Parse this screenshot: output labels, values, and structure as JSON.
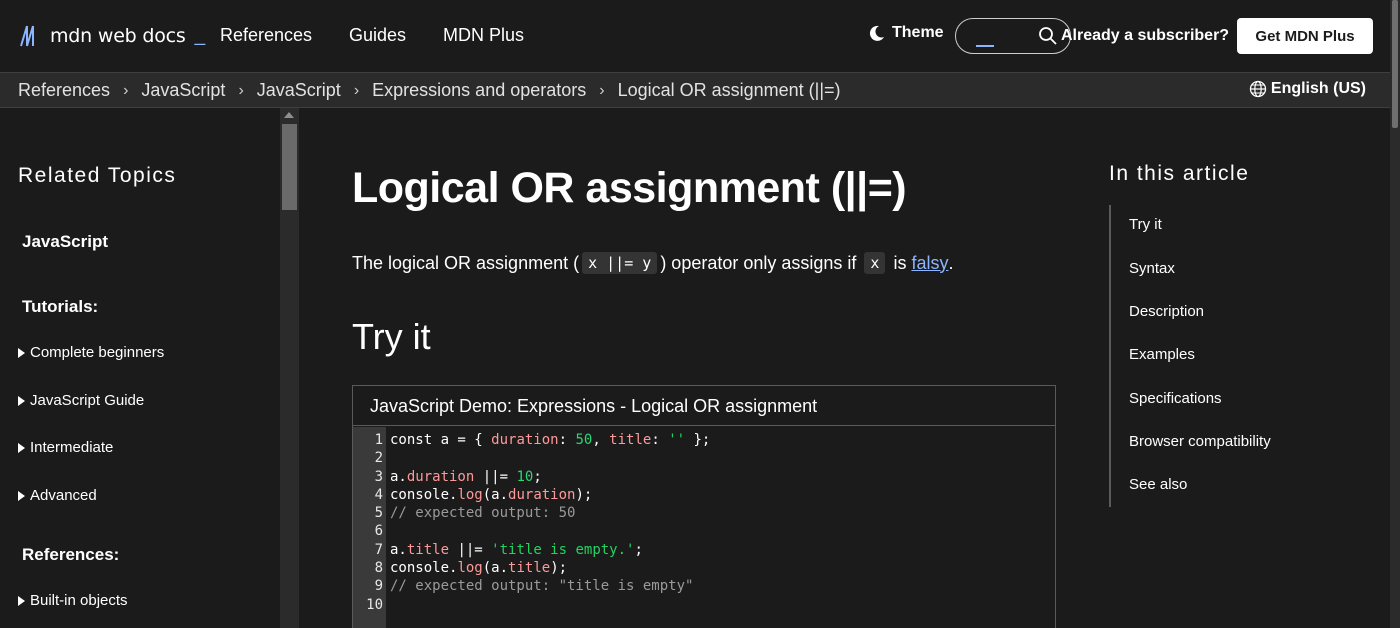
{
  "header": {
    "logo_text": "mdn web docs",
    "logo_underscore": "_",
    "nav": [
      "References",
      "Guides",
      "MDN Plus"
    ],
    "theme_label": "Theme",
    "search": {
      "value": "",
      "placeholder": ""
    },
    "subscriber_text": "Already a subscriber?",
    "get_plus_label": "Get MDN Plus"
  },
  "breadcrumb": {
    "items": [
      "References",
      "JavaScript",
      "JavaScript",
      "Expressions and operators",
      "Logical OR assignment (||=)"
    ],
    "separator": ">",
    "language": "English (US)"
  },
  "sidebar": {
    "heading": "Related Topics",
    "top_link": "JavaScript",
    "tutorials_heading": "Tutorials:",
    "tutorials": [
      "Complete beginners",
      "JavaScript Guide",
      "Intermediate",
      "Advanced"
    ],
    "references_heading": "References:",
    "references": [
      "Built-in objects"
    ]
  },
  "article": {
    "title": "Logical OR assignment (||=)",
    "intro": {
      "before": "The logical OR assignment (",
      "code1": "x ||= y",
      "middle": ") operator only assigns if ",
      "code2": "x",
      "is": " is ",
      "link": "falsy",
      "end": "."
    },
    "try_it_heading": "Try it",
    "demo_title": "JavaScript Demo: Expressions - Logical OR assignment",
    "code_line_numbers": [
      "1",
      "2",
      "3",
      "4",
      "5",
      "6",
      "7",
      "8",
      "9",
      "10"
    ]
  },
  "toc": {
    "heading": "In this article",
    "items": [
      "Try it",
      "Syntax",
      "Description",
      "Examples",
      "Specifications",
      "Browser compatibility",
      "See also"
    ]
  },
  "colors": {
    "background": "#1b1b1b",
    "accent": "#8cb4ff",
    "code_property": "#ff9999",
    "code_number": "#2ed573",
    "code_comment": "#9a9a9a"
  }
}
